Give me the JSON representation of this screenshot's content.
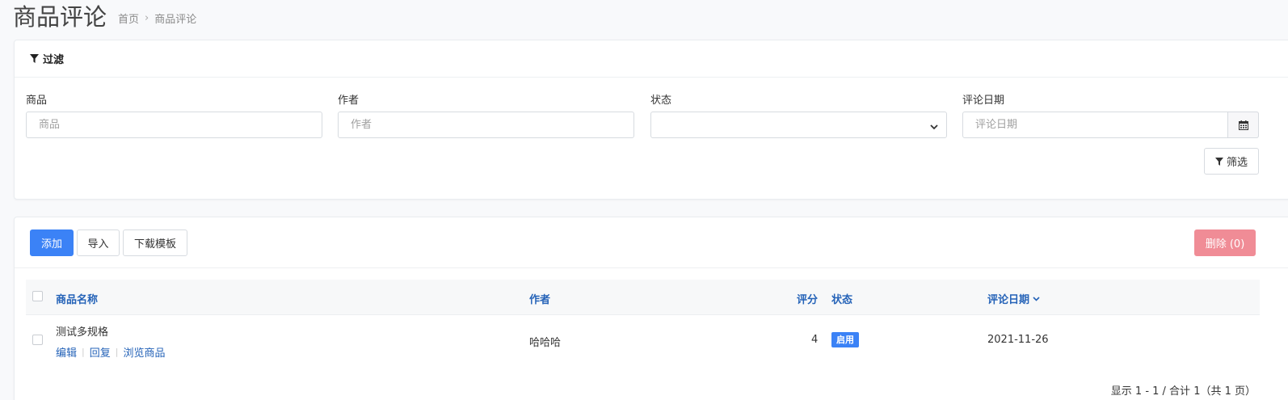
{
  "header": {
    "title": "商品评论",
    "breadcrumb": [
      "首页",
      "商品评论"
    ]
  },
  "filter": {
    "title": "过滤",
    "fields": {
      "product": {
        "label": "商品",
        "placeholder": "商品"
      },
      "author": {
        "label": "作者",
        "placeholder": "作者"
      },
      "status": {
        "label": "状态",
        "value": ""
      },
      "date": {
        "label": "评论日期",
        "placeholder": "评论日期"
      }
    },
    "submit_label": "筛选"
  },
  "toolbar": {
    "add_label": "添加",
    "import_label": "导入",
    "download_label": "下载模板",
    "delete_label": "删除 (0)"
  },
  "table": {
    "columns": [
      "商品名称",
      "作者",
      "评分",
      "状态",
      "评论日期"
    ],
    "rows": [
      {
        "product": "测试多规格",
        "actions": [
          "编辑",
          "回复",
          "浏览商品"
        ],
        "author": "哈哈哈",
        "rating": "4",
        "status": "启用",
        "date": "2021-11-26"
      }
    ]
  },
  "pagination": {
    "summary": "显示 1 - 1 / 合计 1（共 1 页）"
  },
  "colors": {
    "primary": "#3b82f6",
    "link": "#2563b8",
    "danger": "#f08c96",
    "border": "#d7dbe0"
  }
}
